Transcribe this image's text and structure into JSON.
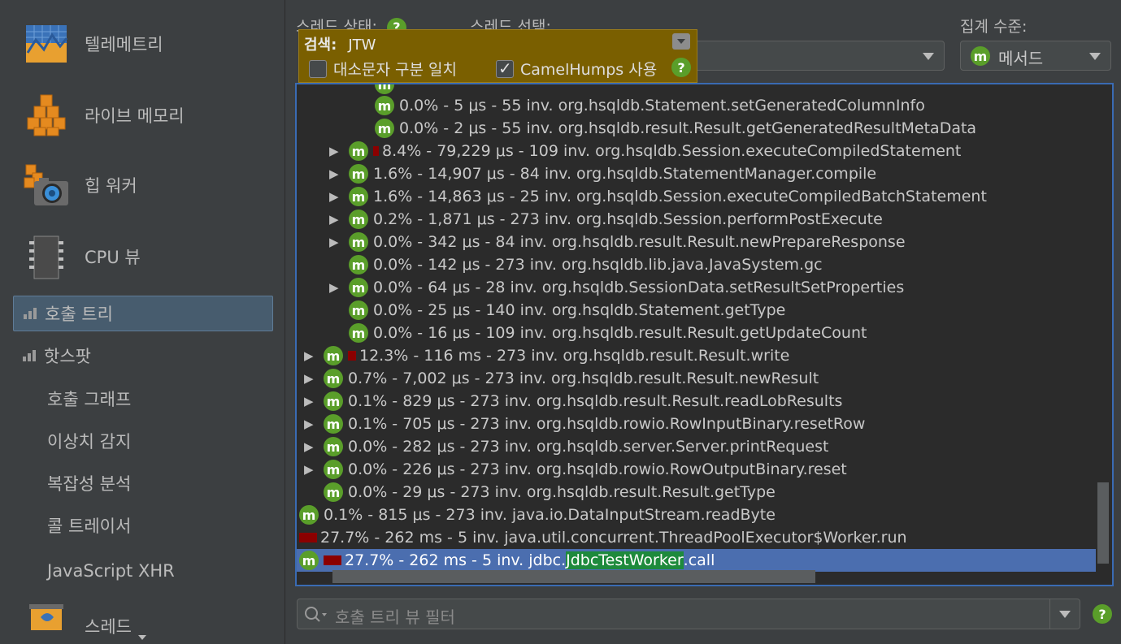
{
  "sidebar": {
    "telemetry": "텔레메트리",
    "live_memory": "라이브 메모리",
    "heap_walker": "힙 워커",
    "cpu_view": "CPU 뷰",
    "call_tree": "호출 트리",
    "hotspots": "핫스팟",
    "call_graph": "호출 그래프",
    "outlier_detection": "이상치 감지",
    "complexity_analysis": "복잡성 분석",
    "call_tracer": "콜 트레이서",
    "javascript_xhr": "JavaScript XHR",
    "threads": "스레드"
  },
  "header": {
    "thread_status_label": "스레드 상태:",
    "thread_select_label": "스레드 선택:",
    "aggregation_label": "집계 수준:",
    "aggregation_value": "메서드",
    "help": "?"
  },
  "search_popup": {
    "label": "검색:",
    "value": "JTW",
    "case_sensitive_label": "대소문자 구분 일치",
    "case_sensitive_checked": false,
    "camelhumps_label": "CamelHumps 사용",
    "camelhumps_checked": true
  },
  "tree": {
    "rows": [
      {
        "text": "0.0% - 5 μs - 55 inv. org.hsqldb.Statement.setGeneratedColumnInfo",
        "expander": false
      },
      {
        "text": "0.0% - 2 μs - 55 inv. org.hsqldb.result.Result.getGeneratedResultMetaData",
        "expander": false
      },
      {
        "text": "8.4% - 79,229 μs - 109 inv. org.hsqldb.Session.executeCompiledStatement",
        "expander": true
      },
      {
        "text": "1.6% - 14,907 μs - 84 inv. org.hsqldb.StatementManager.compile",
        "expander": true
      },
      {
        "text": "1.6% - 14,863 μs - 25 inv. org.hsqldb.Session.executeCompiledBatchStatement",
        "expander": true
      },
      {
        "text": "0.2% - 1,871 μs - 273 inv. org.hsqldb.Session.performPostExecute",
        "expander": true
      },
      {
        "text": "0.0% - 342 μs - 84 inv. org.hsqldb.result.Result.newPrepareResponse",
        "expander": true
      },
      {
        "text": "0.0% - 142 μs - 273 inv. org.hsqldb.lib.java.JavaSystem.gc",
        "expander": false
      },
      {
        "text": "0.0% - 64 μs - 28 inv. org.hsqldb.SessionData.setResultSetProperties",
        "expander": true
      },
      {
        "text": "0.0% - 25 μs - 140 inv. org.hsqldb.Statement.getType",
        "expander": false
      },
      {
        "text": "0.0% - 16 μs - 109 inv. org.hsqldb.result.Result.getUpdateCount",
        "expander": false
      },
      {
        "text": "12.3% - 116 ms - 273 inv. org.hsqldb.result.Result.write",
        "expander": true
      },
      {
        "text": "0.7% - 7,002 μs - 273 inv. org.hsqldb.result.Result.newResult",
        "expander": true
      },
      {
        "text": "0.1% - 829 μs - 273 inv. org.hsqldb.result.Result.readLobResults",
        "expander": true
      },
      {
        "text": "0.1% - 705 μs - 273 inv. org.hsqldb.rowio.RowInputBinary.resetRow",
        "expander": true
      },
      {
        "text": "0.0% - 282 μs - 273 inv. org.hsqldb.server.Server.printRequest",
        "expander": true
      },
      {
        "text": "0.0% - 226 μs - 273 inv. org.hsqldb.rowio.RowOutputBinary.reset",
        "expander": true
      },
      {
        "text": "0.0% - 29 μs - 273 inv. org.hsqldb.result.Result.getType",
        "expander": false
      },
      {
        "text": "0.1% - 815 μs - 273 inv. java.io.DataInputStream.readByte",
        "expander": false
      },
      {
        "text": "27.7% - 262 ms - 5 inv. java.util.concurrent.ThreadPoolExecutor$Worker.run",
        "expander": false
      },
      {
        "prefix": "27.7% - 262 ms - 5 inv. jdbc.",
        "highlight": "JdbcTestWorker",
        "suffix": ".call",
        "expander": false
      }
    ]
  },
  "filter": {
    "placeholder": "호출 트리 뷰 필터"
  },
  "icons": {
    "method": "m"
  }
}
